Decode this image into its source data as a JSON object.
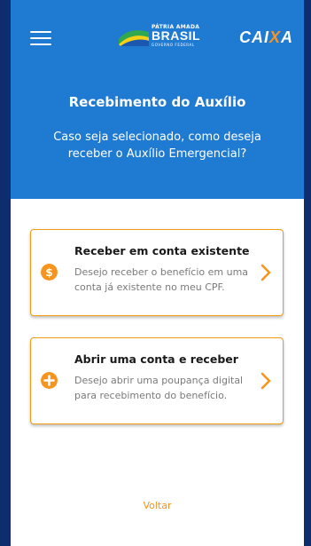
{
  "header": {
    "gov_logo": {
      "top_text": "PÁTRIA AMADA",
      "main_text": "BRASIL",
      "sub_text": "GOVERNO FEDERAL"
    },
    "caixa_logo_prefix": "CAI",
    "caixa_logo_x": "X",
    "caixa_logo_suffix": "A",
    "title": "Recebimento do Auxílio",
    "subtitle": "Caso seja selecionado, como deseja receber o Auxílio Emergencial?"
  },
  "options": [
    {
      "title": "Receber em conta existente",
      "description": "Desejo receber o benefício em uma conta já existente no meu CPF.",
      "icon": "dollar-icon"
    },
    {
      "title": "Abrir uma conta e receber",
      "description": "Desejo abrir uma poupança digital para recebimento do benefício.",
      "icon": "plus-icon"
    }
  ],
  "footer": {
    "back_label": "Voltar"
  },
  "colors": {
    "header_blue": "#1f7ad2",
    "accent_orange": "#f7941d",
    "frame_navy": "#0d2d6e"
  }
}
